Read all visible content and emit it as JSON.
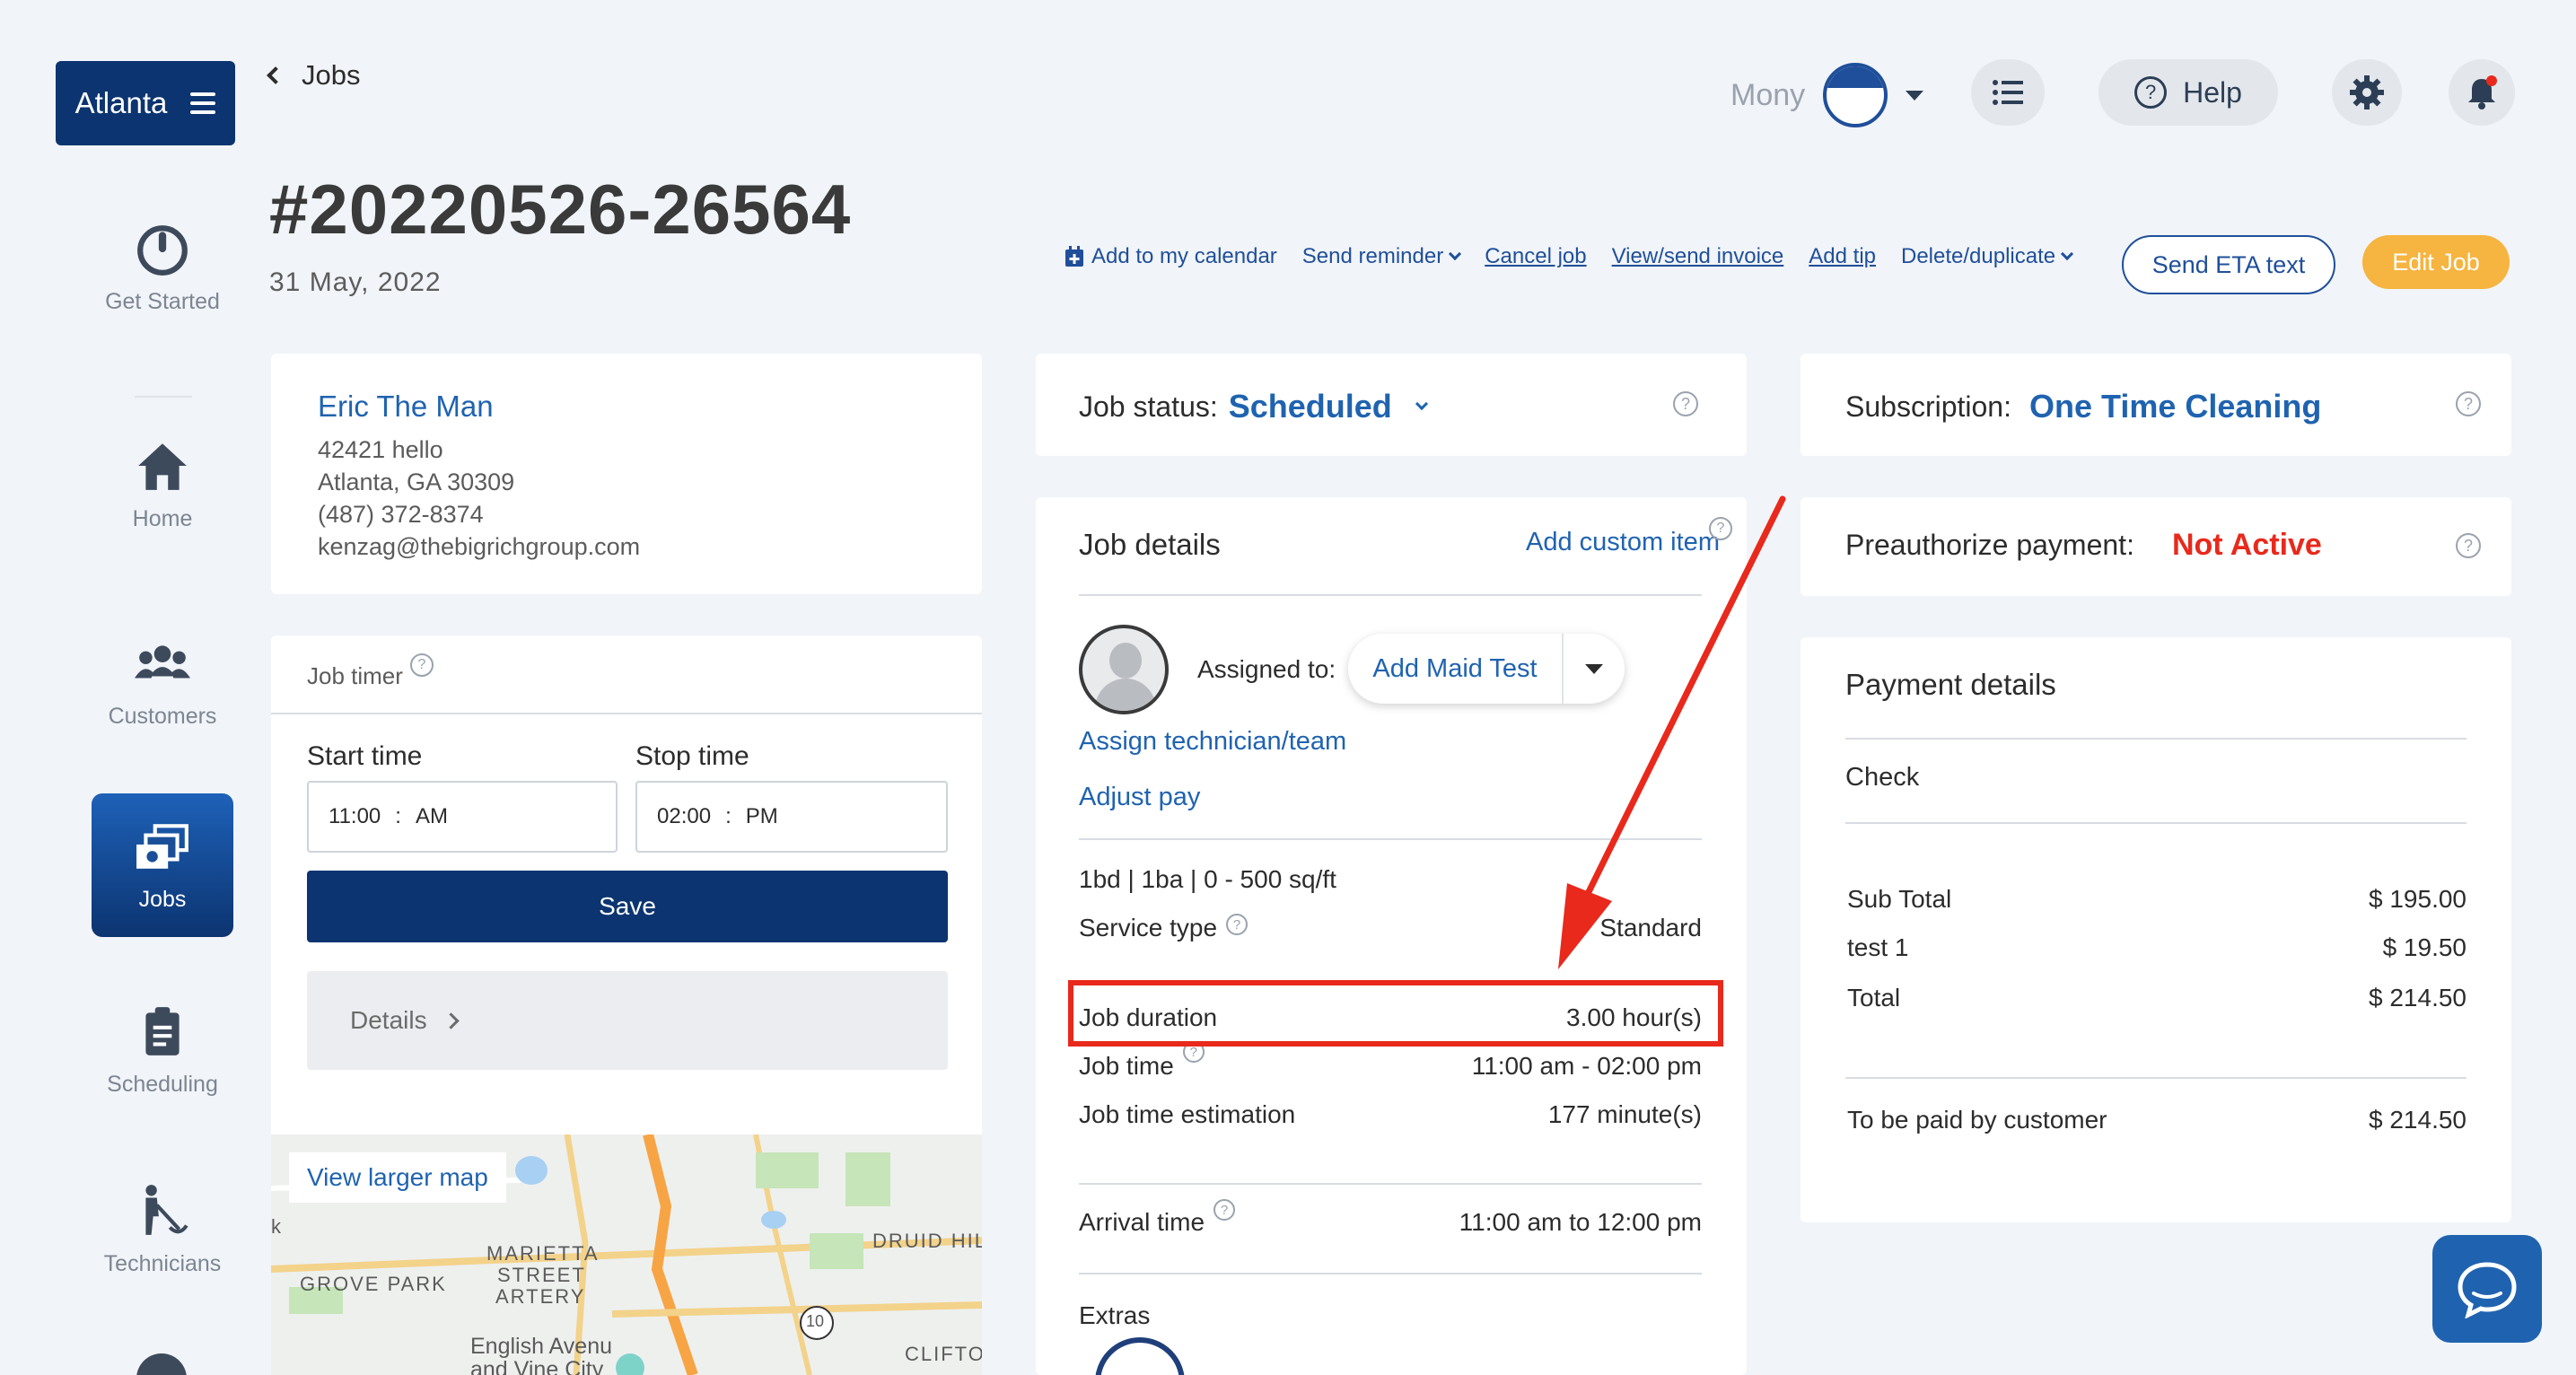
{
  "sidebar": {
    "city": "Atlanta",
    "items": [
      {
        "label": "Get Started"
      },
      {
        "label": "Home"
      },
      {
        "label": "Customers"
      },
      {
        "label": "Jobs"
      },
      {
        "label": "Scheduling"
      },
      {
        "label": "Technicians"
      }
    ]
  },
  "header": {
    "back_label": "Jobs",
    "job_id": "#20220526-26564",
    "date": "31 May, 2022",
    "user_name": "Mony",
    "help_label": "Help"
  },
  "actions": {
    "add_calendar": "Add to my calendar",
    "send_reminder": "Send reminder",
    "cancel_job": "Cancel job",
    "view_invoice": "View/send invoice",
    "add_tip": "Add tip",
    "delete_duplicate": "Delete/duplicate",
    "send_eta": "Send ETA text",
    "edit_job": "Edit Job"
  },
  "customer": {
    "name": "Eric The Man",
    "address1": "42421 hello",
    "address2": "Atlanta, GA 30309",
    "phone": "(487) 372-8374",
    "email": "kenzag@thebigrichgroup.com"
  },
  "timer": {
    "title": "Job timer",
    "start_label": "Start time",
    "start_time": "11:00",
    "start_ampm": "AM",
    "stop_label": "Stop time",
    "stop_time": "02:00",
    "stop_ampm": "PM",
    "save_label": "Save",
    "details_label": "Details"
  },
  "map": {
    "button": "View larger map",
    "labels": [
      "GROVE PARK",
      "MARIETTA",
      "STREET",
      "ARTERY",
      "DRUID HILL",
      "English Avenu",
      "and Vine City",
      "CLIFTO",
      "k",
      "10"
    ]
  },
  "job_status": {
    "label": "Job status:",
    "value": "Scheduled"
  },
  "job_details": {
    "title": "Job details",
    "add_custom": "Add custom item",
    "assigned_label": "Assigned to:",
    "assigned_value": "Add Maid Test",
    "assign_link": "Assign technician/team",
    "adjust_link": "Adjust pay",
    "summary": "1bd | 1ba | 0 - 500 sq/ft",
    "service_type_label": "Service type",
    "service_type_value": "Standard",
    "duration_label": "Job duration",
    "duration_value": "3.00 hour(s)",
    "time_label": "Job time",
    "time_value": "11:00 am - 02:00 pm",
    "estimation_label": "Job time estimation",
    "estimation_value": "177 minute(s)",
    "arrival_label": "Arrival time",
    "arrival_value": "11:00 am to 12:00 pm",
    "extras_label": "Extras"
  },
  "subscription": {
    "label": "Subscription:",
    "value": "One Time Cleaning"
  },
  "preauth": {
    "label": "Preauthorize payment:",
    "value": "Not Active"
  },
  "payment": {
    "title": "Payment details",
    "method": "Check",
    "lines": [
      {
        "label": "Sub Total",
        "value": "$ 195.00"
      },
      {
        "label": "test 1",
        "value": "$ 19.50"
      },
      {
        "label": "Total",
        "value": "$ 214.50"
      }
    ],
    "due_label": "To be paid by customer",
    "due_value": "$ 214.50"
  },
  "colors": {
    "primary": "#0c3470",
    "link": "#1f63b0",
    "accent_orange": "#f6b440",
    "alert_red": "#e8291c",
    "background": "#f1f4f8"
  }
}
